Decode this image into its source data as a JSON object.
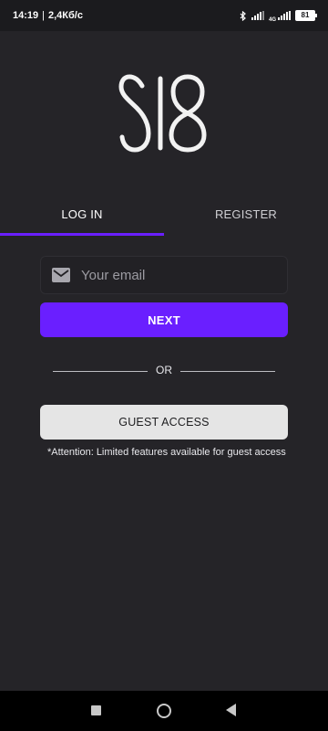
{
  "status_bar": {
    "time": "14:19",
    "separator": "|",
    "data_rate": "2,4Кб/с",
    "network_label": "4G",
    "battery": "81",
    "icons": [
      "bluetooth-icon",
      "signal-icon",
      "signal-4g-icon",
      "battery-icon"
    ]
  },
  "logo": {
    "text": "SI8"
  },
  "tabs": [
    {
      "label": "LOG IN",
      "active": true
    },
    {
      "label": "REGISTER",
      "active": false
    }
  ],
  "email": {
    "placeholder": "Your email",
    "value": "",
    "icon": "mail-icon"
  },
  "buttons": {
    "next_label": "NEXT",
    "guest_label": "GUEST ACCESS"
  },
  "divider": {
    "text": "OR"
  },
  "note": "*Attention: Limited features available for guest access",
  "colors": {
    "accent": "#6a1fff",
    "background": "#252428",
    "guest_button": "#e5e5e5"
  },
  "nav_bar": {
    "icons": [
      "recents-square-icon",
      "home-circle-icon",
      "back-triangle-icon"
    ]
  }
}
